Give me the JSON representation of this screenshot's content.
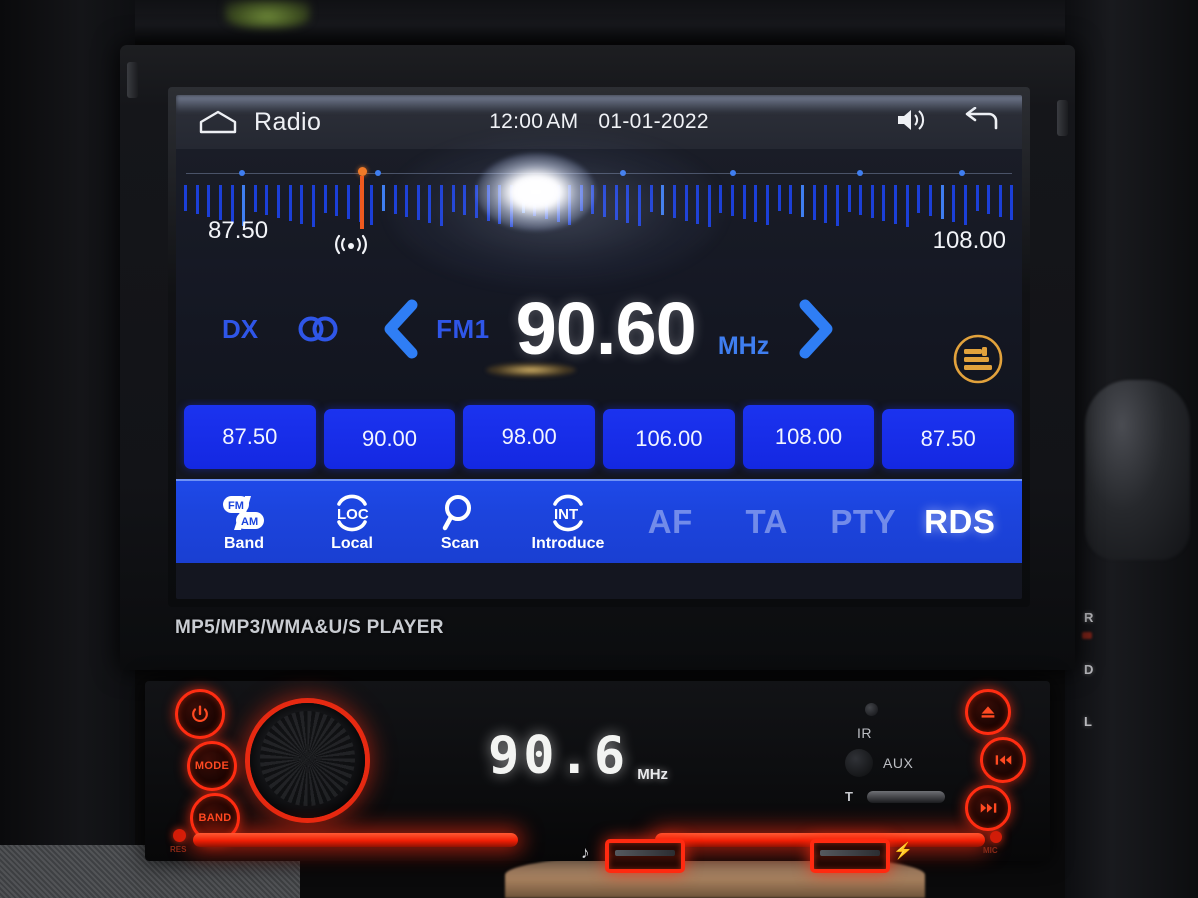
{
  "screen": {
    "statusbar": {
      "home_icon": "home-icon",
      "app_title": "Radio",
      "time": "12:00",
      "ampm": "AM",
      "date": "01-01-2022",
      "volume_icon": "volume-icon",
      "back_icon": "back-arrow-icon"
    },
    "tuner": {
      "scale_min": "87.50",
      "scale_max": "108.00",
      "signal_icon": "signal-strength-icon",
      "marker_position_pct": 21.5,
      "preset_dot_positions_pct": [
        7.5,
        23.5,
        52.5,
        65.5,
        80.5,
        92.5
      ]
    },
    "main": {
      "dx_label": "DX",
      "stereo_icon": "stereo-icon",
      "prev_icon": "chevron-left-icon",
      "band_label": "FM1",
      "frequency": "90.60",
      "unit": "MHz",
      "next_icon": "chevron-right-icon",
      "eq_icon": "equalizer-icon"
    },
    "presets": [
      {
        "label": "87.50"
      },
      {
        "label": "90.00"
      },
      {
        "label": "98.00"
      },
      {
        "label": "106.00"
      },
      {
        "label": "108.00"
      },
      {
        "label": "87.50"
      }
    ],
    "toolbar": {
      "tools": [
        {
          "icon": "fm-am-band-icon",
          "caption": "Band"
        },
        {
          "icon": "loc-local-icon",
          "caption": "Local"
        },
        {
          "icon": "search-scan-icon",
          "caption": "Scan"
        },
        {
          "icon": "int-introduce-icon",
          "caption": "Introduce"
        }
      ],
      "rds_items": [
        {
          "label": "AF",
          "active": false
        },
        {
          "label": "TA",
          "active": false
        },
        {
          "label": "PTY",
          "active": false
        },
        {
          "label": "RDS",
          "active": true
        }
      ]
    },
    "colors": {
      "preset_blue": "#1b33ef",
      "toolbar_blue": "#1e49e8",
      "accent_blue": "#2f56e8",
      "marker_orange": "#ef5a1e",
      "eq_orange": "#e2a23c"
    }
  },
  "chassis": {
    "model_text": "MP5/MP3/WMA&U/S PLAYER"
  },
  "panel": {
    "power_icon": "power-icon",
    "mode_label": "MODE",
    "band_label": "BAND",
    "knob_name": "volume-knob",
    "res_label": "RES",
    "led_frequency": "90.6",
    "led_unit": "MHz",
    "usb_music_icon": "music-note-icon",
    "usb_charge_icon": "lightning-charge-icon",
    "ir_label": "IR",
    "aux_label": "AUX",
    "t_label": "T",
    "eject_icon": "eject-icon",
    "prev_icon": "previous-track-icon",
    "next_icon": "next-track-icon",
    "mic_label": "MIC"
  },
  "environment": {
    "shift_letters": [
      "R",
      "D",
      "L"
    ]
  }
}
